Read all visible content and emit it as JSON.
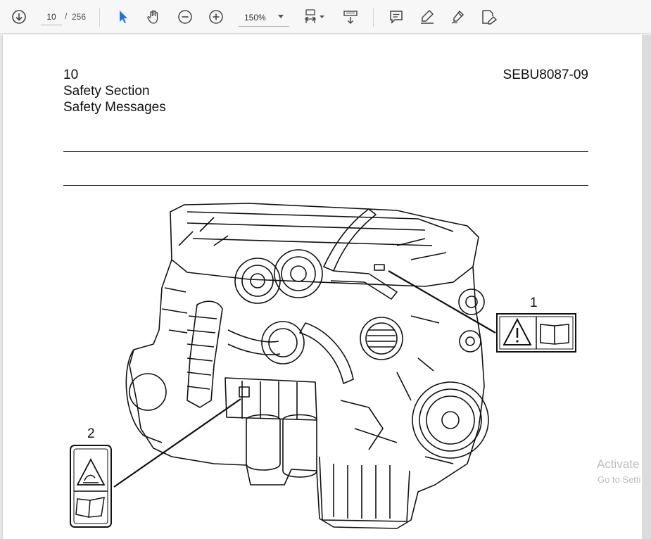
{
  "toolbar": {
    "page_current": "10",
    "page_separator": "/",
    "page_total": "256",
    "zoom_value": "150%",
    "icons": [
      "download-icon",
      "select-cursor-icon",
      "hand-icon",
      "zoom-out-icon",
      "zoom-in-icon",
      "fit-page-icon",
      "rotate-icon",
      "comment-icon",
      "highlight-icon",
      "draw-icon",
      "edit-text-icon"
    ],
    "accent": "#1a73e8"
  },
  "document": {
    "page_number": "10",
    "section": "Safety Section",
    "subsection": "Safety Messages",
    "doc_id": "SEBU8087-09",
    "callout_1": "1",
    "callout_2": "2"
  },
  "watermark": {
    "line1": "Activate",
    "line2": "Go to Setti"
  }
}
